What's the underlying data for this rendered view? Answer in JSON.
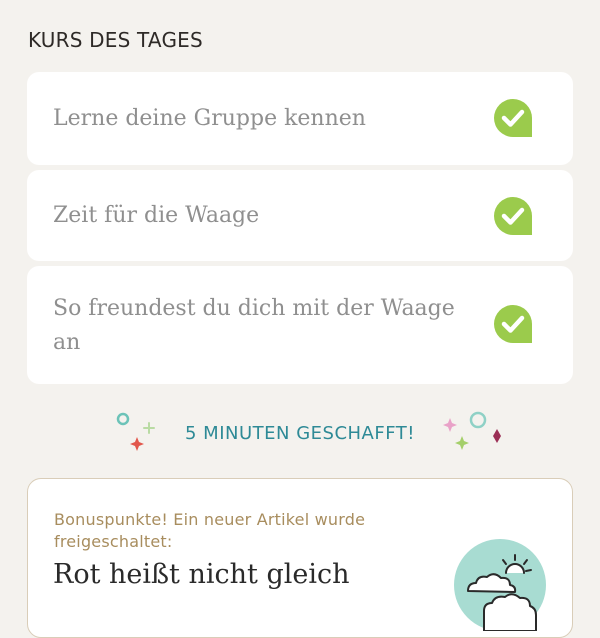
{
  "section": {
    "title": "KURS DES TAGES"
  },
  "courses": [
    {
      "title": "Lerne deine Gruppe kennen",
      "completed": true
    },
    {
      "title": "Zeit für die Waage",
      "completed": true
    },
    {
      "title": "So freundest du dich mit der Waage an",
      "completed": true
    }
  ],
  "progress": {
    "label": "5 MINUTEN GESCHAFFT!"
  },
  "bonus": {
    "text": "Bonuspunkte! Ein neuer Artikel wurde freigeschaltet:",
    "article_title": "Rot heißt nicht gleich"
  },
  "icons": {
    "check": "checkmark-bubble-icon",
    "weather": "cloud-sun-icon"
  },
  "colors": {
    "check_green": "#9bcb4c",
    "accent_teal": "#2e8a96",
    "bonus_gold": "#a88d5e",
    "bonus_border": "#d9cdb8",
    "illustration_bg": "#a8dcd2"
  }
}
